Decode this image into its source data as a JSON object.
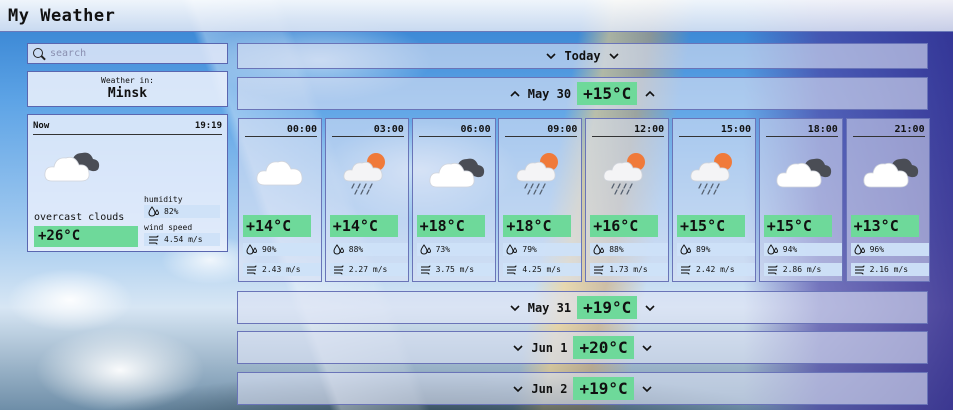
{
  "app": {
    "title": "My Weather"
  },
  "search": {
    "placeholder": "search"
  },
  "location": {
    "label": "Weather in:",
    "city": "Minsk"
  },
  "now": {
    "label": "Now",
    "time": "19:19",
    "icon": "cloud-overcast-icon",
    "description": "overcast clouds",
    "temperature": "+26°C",
    "humidity_label": "humidity",
    "humidity": "82%",
    "wind_label": "wind speed",
    "wind": "4.54 m/s"
  },
  "days": [
    {
      "label": "Today",
      "temp": "",
      "expanded": false,
      "chevron": "down"
    },
    {
      "label": "May 30",
      "temp": "+15°C",
      "expanded": true,
      "chevron": "up"
    },
    {
      "label": "May 31",
      "temp": "+19°C",
      "expanded": false,
      "chevron": "down"
    },
    {
      "label": "Jun 1",
      "temp": "+20°C",
      "expanded": false,
      "chevron": "down"
    },
    {
      "label": "Jun 2",
      "temp": "+19°C",
      "expanded": false,
      "chevron": "down"
    }
  ],
  "hours": [
    {
      "time": "00:00",
      "icon": "cloud-icon",
      "temp": "+14°C",
      "humidity": "90%",
      "wind": "2.43 m/s"
    },
    {
      "time": "03:00",
      "icon": "sun-cloud-rain-icon",
      "temp": "+14°C",
      "humidity": "88%",
      "wind": "2.27 m/s"
    },
    {
      "time": "06:00",
      "icon": "cloud-overcast-icon",
      "temp": "+18°C",
      "humidity": "73%",
      "wind": "3.75 m/s"
    },
    {
      "time": "09:00",
      "icon": "sun-cloud-rain-icon",
      "temp": "+18°C",
      "humidity": "79%",
      "wind": "4.25 m/s"
    },
    {
      "time": "12:00",
      "icon": "sun-cloud-rain-icon",
      "temp": "+16°C",
      "humidity": "88%",
      "wind": "1.73 m/s"
    },
    {
      "time": "15:00",
      "icon": "sun-cloud-rain-icon",
      "temp": "+15°C",
      "humidity": "89%",
      "wind": "2.42 m/s"
    },
    {
      "time": "18:00",
      "icon": "cloud-overcast-icon",
      "temp": "+15°C",
      "humidity": "94%",
      "wind": "2.86 m/s"
    },
    {
      "time": "21:00",
      "icon": "cloud-overcast-icon",
      "temp": "+13°C",
      "humidity": "96%",
      "wind": "2.16 m/s"
    }
  ],
  "colors": {
    "temp_badge": "#6ed99a",
    "sun": "#f07a3a",
    "accent_border": "#6a74b8"
  }
}
